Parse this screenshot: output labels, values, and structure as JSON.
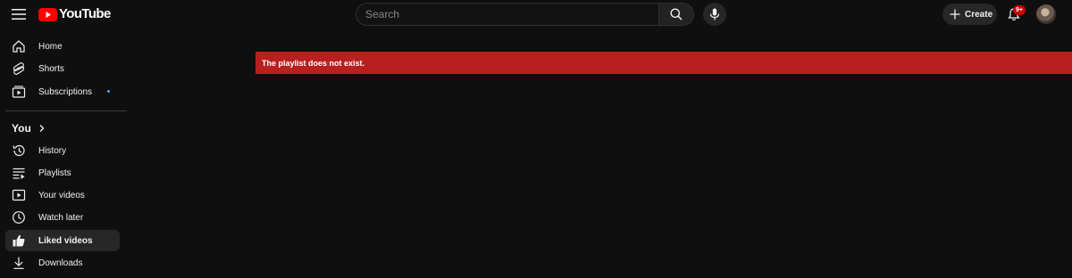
{
  "masthead": {
    "logo_text": "YouTube",
    "search_placeholder": "Search",
    "create_label": "Create",
    "notification_badge": "9+"
  },
  "sidebar": {
    "main_items": [
      {
        "label": "Home",
        "icon": "home-icon"
      },
      {
        "label": "Shorts",
        "icon": "shorts-icon"
      },
      {
        "label": "Subscriptions",
        "icon": "subscriptions-icon",
        "has_new_dot": true
      }
    ],
    "you_section_label": "You",
    "you_items": [
      {
        "label": "History",
        "icon": "history-icon"
      },
      {
        "label": "Playlists",
        "icon": "playlists-icon"
      },
      {
        "label": "Your videos",
        "icon": "your-videos-icon"
      },
      {
        "label": "Watch later",
        "icon": "watch-later-icon"
      },
      {
        "label": "Liked videos",
        "icon": "liked-icon",
        "active": true
      },
      {
        "label": "Downloads",
        "icon": "downloads-icon"
      }
    ]
  },
  "main": {
    "error_message": "The playlist does not exist."
  },
  "colors": {
    "background": "#0f0f0f",
    "brand_red": "#ff0000",
    "error_banner": "#b91f1f",
    "active_item": "#272727",
    "new_dot": "#3ea6ff"
  }
}
